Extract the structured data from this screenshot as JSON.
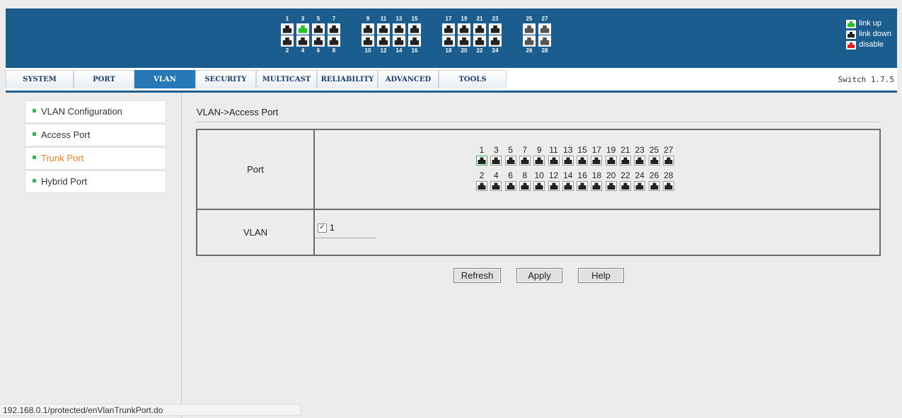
{
  "header": {
    "top_port_numbers": [
      "1",
      "3",
      "5",
      "7",
      "9",
      "11",
      "13",
      "15",
      "17",
      "19",
      "21",
      "23",
      "25",
      "27"
    ],
    "bottom_port_numbers": [
      "2",
      "4",
      "6",
      "8",
      "10",
      "12",
      "14",
      "16",
      "18",
      "20",
      "22",
      "24",
      "26",
      "28"
    ],
    "legend": [
      {
        "label": "link up",
        "color": "#27c12a",
        "icon": "port-link-up-icon"
      },
      {
        "label": "link down",
        "color": "#222222",
        "icon": "port-link-down-icon"
      },
      {
        "label": "disable",
        "color": "#e02020",
        "icon": "port-disable-icon"
      }
    ],
    "active_port": "3"
  },
  "tabs": [
    {
      "label": "SYSTEM"
    },
    {
      "label": "PORT"
    },
    {
      "label": "VLAN"
    },
    {
      "label": "SECURITY"
    },
    {
      "label": "MULTICAST"
    },
    {
      "label": "RELIABILITY"
    },
    {
      "label": "ADVANCED"
    },
    {
      "label": "TOOLS"
    }
  ],
  "active_tab": "VLAN",
  "version": "Switch 1.7.5",
  "sidebar": {
    "items": [
      {
        "label": "VLAN Configuration"
      },
      {
        "label": "Access Port"
      },
      {
        "label": "Trunk Port"
      },
      {
        "label": "Hybrid Port"
      }
    ],
    "active": "Trunk Port"
  },
  "breadcrumb": "VLAN->Access Port",
  "form": {
    "port_label": "Port",
    "vlan_label": "VLAN",
    "top_ports": [
      "1",
      "3",
      "5",
      "7",
      "9",
      "11",
      "13",
      "15",
      "17",
      "19",
      "21",
      "23",
      "25",
      "27"
    ],
    "bottom_ports": [
      "2",
      "4",
      "6",
      "8",
      "10",
      "12",
      "14",
      "16",
      "18",
      "20",
      "22",
      "24",
      "26",
      "28"
    ],
    "selected_port": "1",
    "vlan_value": "1",
    "vlan_checked": true
  },
  "buttons": {
    "refresh": "Refresh",
    "apply": "Apply",
    "help": "Help"
  },
  "status_url": "192.168.0.1/protected/enVlanTrunkPort.do",
  "colors": {
    "header_bg": "#1c5d8f",
    "active_tab_bg": "#2778b6",
    "active_sidebar": "#ff7a1c",
    "bullet": "#35b35a",
    "link_up": "#27c12a"
  }
}
